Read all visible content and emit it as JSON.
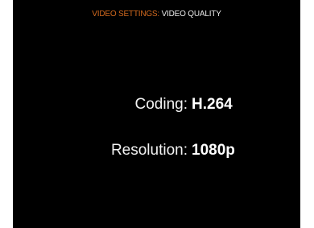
{
  "header": {
    "section": "VIDEO SETTINGS",
    "separator": ":",
    "page": "VIDEO QUALITY",
    "section_color": "#d2691e",
    "page_color": "#e8e8e8"
  },
  "settings": [
    {
      "label": "Coding:",
      "value": "H.264"
    },
    {
      "label": "Resolution:",
      "value": "1080p"
    }
  ],
  "background_color": "#000000"
}
